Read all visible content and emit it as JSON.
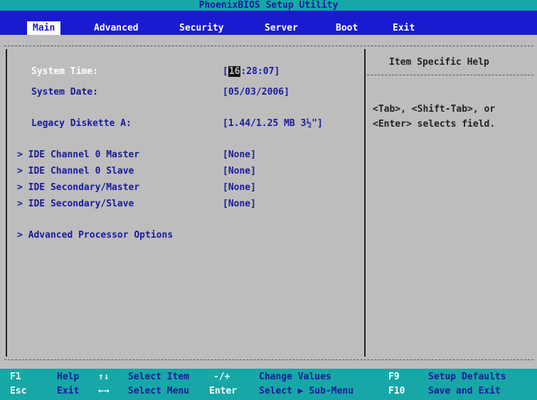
{
  "title": "PhoenixBIOS Setup Utility",
  "menu": [
    "Main",
    "Advanced",
    "Security",
    "Server",
    "Boot",
    "Exit"
  ],
  "active_menu": "Main",
  "fields": {
    "system_time_label": "System Time:",
    "system_time_cursor": "16",
    "system_time_rest": ":28:07]",
    "system_time_open": "[",
    "system_date_label": "System Date:",
    "system_date_value": "[05/03/2006]",
    "legacy_diskette_label": "Legacy Diskette A:",
    "legacy_diskette_value": "[1.44/1.25 MB  3½\"]"
  },
  "submenus": [
    {
      "label": "> IDE Channel 0 Master",
      "value": "[None]"
    },
    {
      "label": "> IDE Channel 0 Slave",
      "value": "[None]"
    },
    {
      "label": "> IDE Secondary/Master",
      "value": "[None]"
    },
    {
      "label": "> IDE Secondary/Slave",
      "value": "[None]"
    }
  ],
  "advanced_processor": "> Advanced Processor Options",
  "help": {
    "title": "Item Specific Help",
    "line1": "<Tab>, <Shift-Tab>, or",
    "line2": "<Enter> selects field."
  },
  "footer": {
    "row1": [
      {
        "key": "F1",
        "desc": "Help"
      },
      {
        "key": "↑↓",
        "desc": "Select Item"
      },
      {
        "key": "-/+",
        "desc": "Change Values"
      },
      {
        "key": "F9",
        "desc": "Setup Defaults"
      }
    ],
    "row2": [
      {
        "key": "Esc",
        "desc": "Exit"
      },
      {
        "key": "←→",
        "desc": "Select Menu"
      },
      {
        "key": "Enter",
        "desc": "Select ▶ Sub-Menu"
      },
      {
        "key": "F10",
        "desc": "Save and Exit"
      }
    ]
  },
  "colors": {
    "title_bg": "#17a7a7",
    "menu_bg": "#1a1ad0",
    "panel_bg": "#bdbdbd",
    "text_blue": "#1a1a9a"
  }
}
